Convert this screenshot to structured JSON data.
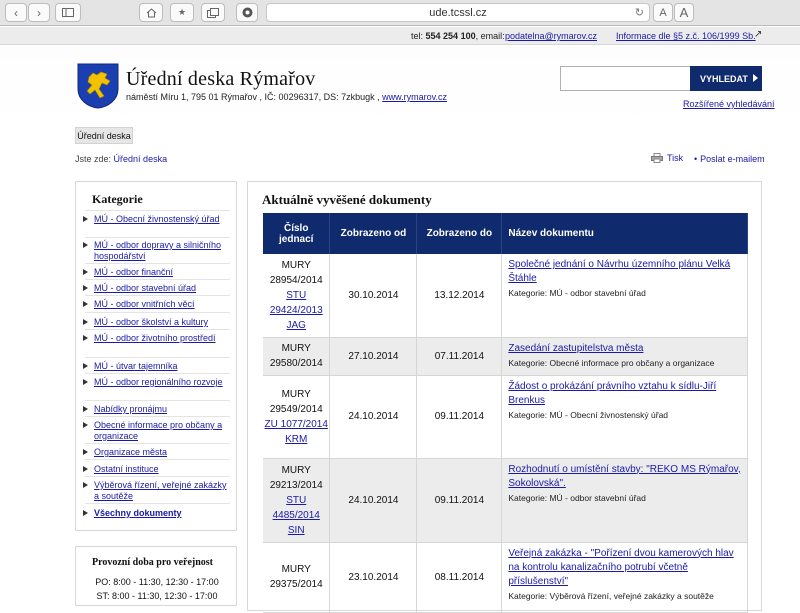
{
  "browser": {
    "url": "ude.tcssl.cz",
    "reader_a_small": "A",
    "reader_a_large": "A"
  },
  "topbar": {
    "tel_label": "tel:",
    "tel_number": "554 254 100",
    "email_label": ", email:",
    "email": "podatelna@rymarov.cz",
    "info_link": "Informace dle §5 z.č. 106/1999 Sb."
  },
  "header": {
    "title": "Úřední deska Rýmařov",
    "address": "náměstí Míru 1, 795 01 Rýmařov , IČ: 00296317, DS: 7zkbugk ,",
    "website": "www.rymarov.cz",
    "search_placeholder": "",
    "search_button": "VYHLEDAT",
    "advanced_search": "Rozšířené vyhledávání"
  },
  "nav": {
    "tab": "Úřední deska"
  },
  "breadcrumb": {
    "prefix": "Jste zde:",
    "current": "Úřední deska"
  },
  "tools": {
    "print": "Tisk",
    "email": "Poslat e-mailem"
  },
  "sidebar": {
    "title": "Kategorie",
    "items": [
      {
        "label": "MÚ - Obecní živnostenský úřad"
      },
      {
        "label": "MÚ - odbor dopravy a silničního hospodářství"
      },
      {
        "label": "MÚ - odbor finanční"
      },
      {
        "label": "MÚ - odbor stavební úřad"
      },
      {
        "label": "MÚ - odbor vnitřních věcí"
      },
      {
        "label": "MÚ - odbor školství a kultury"
      },
      {
        "label": "MÚ - odbor životního prostředí"
      },
      {
        "label": "MÚ - útvar tajemníka"
      },
      {
        "label": "MÚ - odbor regionálního rozvoje"
      },
      {
        "label": "Nabídky pronájmu"
      },
      {
        "label": "Obecné informace pro občany a organizace"
      },
      {
        "label": "Organizace města"
      },
      {
        "label": "Ostatní instituce"
      },
      {
        "label": "Výběrová řízení, veřejné zakázky a soutěže"
      },
      {
        "label": "Všechny dokumenty"
      }
    ]
  },
  "hours": {
    "title": "Provozní doba pro veřejnost",
    "rows": [
      {
        "label": "PO: 8:00 - 11:30, 12:30 - 17:00"
      },
      {
        "label": "ST: 8:00 - 11:30, 12:30 - 17:00"
      }
    ]
  },
  "main": {
    "title": "Aktuálně vyvěšené dokumenty",
    "columns": [
      "Číslo jednací",
      "Zobrazeno od",
      "Zobrazeno do",
      "Název dokumentu"
    ],
    "rows": [
      {
        "cj_line1": "MURY",
        "cj_line2": "28954/2014",
        "cj_ref": "STU 29424/2013 JAG",
        "from": "30.10.2014",
        "to": "13.12.2014",
        "title": "Společné jednání o Návrhu územního plánu Velká Štáhle",
        "category": "Kategorie: MÚ - odbor stavební úřad"
      },
      {
        "cj_line1": "MURY",
        "cj_line2": "29580/2014",
        "cj_ref": "",
        "from": "27.10.2014",
        "to": "07.11.2014",
        "title": "Zasedání zastupitelstva města",
        "category": "Kategorie: Obecné informace pro občany a organizace"
      },
      {
        "cj_line1": "MURY",
        "cj_line2": "29549/2014",
        "cj_ref": "ZU 1077/2014 KRM",
        "from": "24.10.2014",
        "to": "09.11.2014",
        "title": "Žádost o prokázání právního vztahu k sídlu-Jiří Brenkus",
        "category": "Kategorie: MÚ - Obecní živnostenský úřad"
      },
      {
        "cj_line1": "MURY",
        "cj_line2": "29213/2014",
        "cj_ref": "STU 4485/2014 SIN",
        "from": "24.10.2014",
        "to": "09.11.2014",
        "title": "Rozhodnutí o umístění stavby: \"REKO MS Rýmařov, Sokolovská\".",
        "category": "Kategorie: MÚ - odbor stavební úřad"
      },
      {
        "cj_line1": "MURY",
        "cj_line2": "29375/2014",
        "cj_ref": "",
        "from": "23.10.2014",
        "to": "08.11.2014",
        "title": "Veřejná zakázka - \"Pořízení dvou kamerových hlav na kontrolu kanalizačního potrubí včetně příslušenství\"",
        "category": "Kategorie: Výběrová řízení, veřejné zakázky a soutěže"
      }
    ]
  }
}
